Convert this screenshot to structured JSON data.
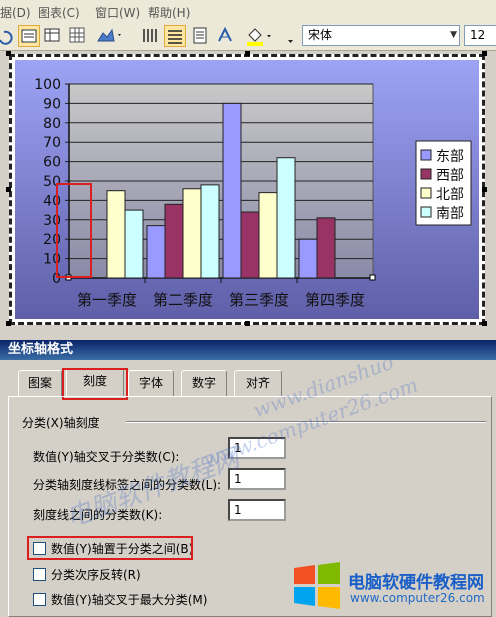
{
  "menu": {
    "items": [
      {
        "label": "据(D)",
        "x": 0
      },
      {
        "label": "图表(C)",
        "x": 38
      },
      {
        "label": "窗口(W)",
        "x": 95
      },
      {
        "label": "帮助(H)",
        "x": 148
      }
    ]
  },
  "toolbar": {
    "font_name": "宋体",
    "font_size": "12"
  },
  "chart_data": {
    "type": "bar",
    "categories": [
      "第一季度",
      "第二季度",
      "第三季度",
      "第四季度"
    ],
    "series": [
      {
        "name": "东部",
        "values": [
          0,
          27,
          90,
          20
        ],
        "color": "#9999ff"
      },
      {
        "name": "西部",
        "values": [
          0,
          38,
          34,
          31
        ],
        "color": "#993366"
      },
      {
        "name": "北部",
        "values": [
          45,
          46,
          44,
          0
        ],
        "color": "#ffffcc"
      },
      {
        "name": "南部",
        "values": [
          35,
          48,
          62,
          0
        ],
        "color": "#ccffff"
      }
    ],
    "y_ticks": [
      "0",
      "10",
      "20",
      "30",
      "40",
      "50",
      "60",
      "70",
      "80",
      "90",
      "100"
    ],
    "ylim": [
      0,
      100
    ],
    "grid": true,
    "legend": "right"
  },
  "dialog": {
    "title": "坐标轴格式",
    "tabs": [
      "图案",
      "刻度",
      "字体",
      "数字",
      "对齐"
    ],
    "active_tab": "刻度",
    "section_label": "分类(X)轴刻度",
    "fields": [
      {
        "label": "数值(Y)轴交叉于分类数(C):",
        "value": "1"
      },
      {
        "label": "分类轴刻度线标签之间的分类数(L):",
        "value": "1"
      },
      {
        "label": "刻度线之间的分类数(K):",
        "value": "1"
      }
    ],
    "checkboxes": [
      {
        "label": "数值(Y)轴置于分类之间(B)",
        "checked": false
      },
      {
        "label": "分类次序反转(R)",
        "checked": false
      },
      {
        "label": "数值(Y)轴交叉于最大分类(M)",
        "checked": false
      }
    ]
  },
  "watermark": {
    "cn": "电脑软件教程网",
    "url": "www.computer26.com",
    "diag": "www.dianshuo"
  },
  "logo": {
    "title": "电脑软硬件教程网",
    "url": "www.computer26.com",
    "colors": {
      "red": "#f25022",
      "green": "#7fba00",
      "blue": "#00a4ef",
      "yellow": "#ffb900"
    }
  }
}
